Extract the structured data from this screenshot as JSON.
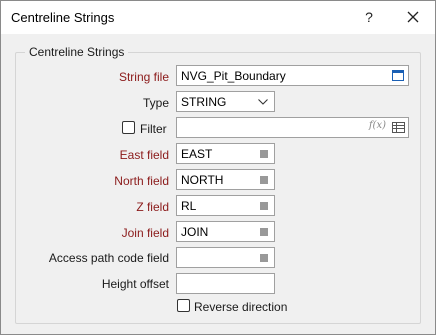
{
  "window": {
    "title": "Centreline Strings"
  },
  "titlebar": {
    "help_label": "?",
    "close_label": "✕"
  },
  "group": {
    "legend": "Centreline Strings"
  },
  "form": {
    "string_file": {
      "label": "String file",
      "value": "NVG_Pit_Boundary"
    },
    "type": {
      "label": "Type",
      "value": "STRING"
    },
    "filter": {
      "label": "Filter",
      "value": "",
      "checked": false
    },
    "east_field": {
      "label": "East field",
      "value": "EAST"
    },
    "north_field": {
      "label": "North field",
      "value": "NORTH"
    },
    "z_field": {
      "label": "Z field",
      "value": "RL"
    },
    "join_field": {
      "label": "Join field",
      "value": "JOIN"
    },
    "access_path_code_field": {
      "label": "Access path code field",
      "value": ""
    },
    "height_offset": {
      "label": "Height offset",
      "value": ""
    },
    "reverse_direction": {
      "label": "Reverse direction",
      "checked": false
    }
  },
  "colors": {
    "required_label": "#8b1a1a",
    "icon_blue": "#1a5fb4"
  },
  "icons": {
    "string_file_browse": "file-browse-icon",
    "type_dropdown": "chevron-down-icon",
    "filter_expression": "function-icon",
    "filter_list": "table-icon",
    "field_list": "list-icon"
  }
}
